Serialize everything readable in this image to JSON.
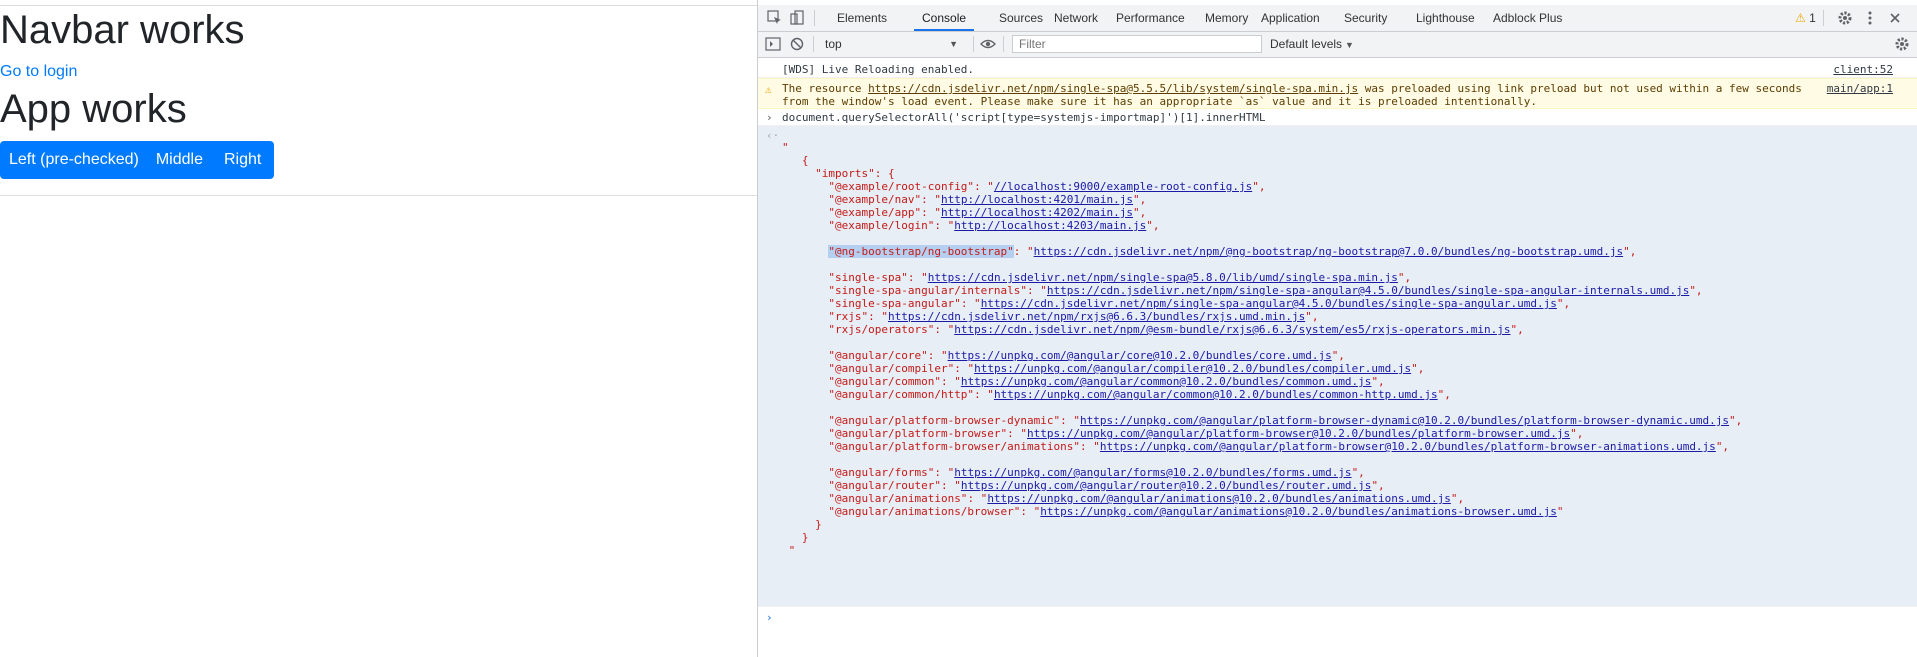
{
  "app": {
    "navbar_heading": "Navbar works",
    "login_link": "Go to login",
    "app_heading": "App works",
    "buttons": [
      "Left (pre-checked)",
      "Middle",
      "Right"
    ]
  },
  "devtools": {
    "tabs": [
      "Elements",
      "Console",
      "Sources",
      "Network",
      "Performance",
      "Memory",
      "Application",
      "Security",
      "Lighthouse",
      "Adblock Plus"
    ],
    "active_tab": "Console",
    "warning_count": "1",
    "context": "top",
    "filter_placeholder": "Filter",
    "levels": "Default levels",
    "messages": {
      "wds": {
        "text": "[WDS] Live Reloading enabled.",
        "source": "client:52"
      },
      "preload": {
        "line1_pre": "The resource ",
        "line1_url": "https://cdn.jsdelivr.net/npm/single-spa@5.5.5/lib/system/single-spa.min.js",
        "line1_post": " was preloaded using link preload but not used within a few seconds",
        "line2": "from the window's load event. Please make sure it has an appropriate `as` value and it is preloaded intentionally.",
        "source": "main/app:1"
      },
      "command": "document.querySelectorAll('script[type=systemjs-importmap]')[1].innerHTML"
    },
    "result": {
      "open_quote": "\"",
      "brace_open": "{",
      "imports_key": "\"imports\": {",
      "groups": [
        [
          {
            "key": "\"@example/root-config\"",
            "url": "//localhost:9000/example-root-config.js"
          },
          {
            "key": "\"@example/nav\"",
            "url": "http://localhost:4201/main.js"
          },
          {
            "key": "\"@example/app\"",
            "url": "http://localhost:4202/main.js"
          },
          {
            "key": "\"@example/login\"",
            "url": "http://localhost:4203/main.js"
          }
        ],
        [
          {
            "key": "\"@ng-bootstrap/ng-bootstrap\"",
            "url": "https://cdn.jsdelivr.net/npm/@ng-bootstrap/ng-bootstrap@7.0.0/bundles/ng-bootstrap.umd.js",
            "highlight": true
          }
        ],
        [
          {
            "key": "\"single-spa\"",
            "url": "https://cdn.jsdelivr.net/npm/single-spa@5.8.0/lib/umd/single-spa.min.js"
          },
          {
            "key": "\"single-spa-angular/internals\"",
            "url": "https://cdn.jsdelivr.net/npm/single-spa-angular@4.5.0/bundles/single-spa-angular-internals.umd.js"
          },
          {
            "key": "\"single-spa-angular\"",
            "url": "https://cdn.jsdelivr.net/npm/single-spa-angular@4.5.0/bundles/single-spa-angular.umd.js"
          },
          {
            "key": "\"rxjs\"",
            "url": "https://cdn.jsdelivr.net/npm/rxjs@6.6.3/bundles/rxjs.umd.min.js"
          },
          {
            "key": "\"rxjs/operators\"",
            "url": "https://cdn.jsdelivr.net/npm/@esm-bundle/rxjs@6.6.3/system/es5/rxjs-operators.min.js"
          }
        ],
        [
          {
            "key": "\"@angular/core\"",
            "url": "https://unpkg.com/@angular/core@10.2.0/bundles/core.umd.js"
          },
          {
            "key": "\"@angular/compiler\"",
            "url": "https://unpkg.com/@angular/compiler@10.2.0/bundles/compiler.umd.js"
          },
          {
            "key": "\"@angular/common\"",
            "url": "https://unpkg.com/@angular/common@10.2.0/bundles/common.umd.js"
          },
          {
            "key": "\"@angular/common/http\"",
            "url": "https://unpkg.com/@angular/common@10.2.0/bundles/common-http.umd.js"
          }
        ],
        [
          {
            "key": "\"@angular/platform-browser-dynamic\"",
            "url": "https://unpkg.com/@angular/platform-browser-dynamic@10.2.0/bundles/platform-browser-dynamic.umd.js"
          },
          {
            "key": "\"@angular/platform-browser\"",
            "url": "https://unpkg.com/@angular/platform-browser@10.2.0/bundles/platform-browser.umd.js"
          },
          {
            "key": "\"@angular/platform-browser/animations\"",
            "url": "https://unpkg.com/@angular/platform-browser@10.2.0/bundles/platform-browser-animations.umd.js"
          }
        ],
        [
          {
            "key": "\"@angular/forms\"",
            "url": "https://unpkg.com/@angular/forms@10.2.0/bundles/forms.umd.js"
          },
          {
            "key": "\"@angular/router\"",
            "url": "https://unpkg.com/@angular/router@10.2.0/bundles/router.umd.js"
          },
          {
            "key": "\"@angular/animations\"",
            "url": "https://unpkg.com/@angular/animations@10.2.0/bundles/animations.umd.js"
          },
          {
            "key": "\"@angular/animations/browser\"",
            "url": "https://unpkg.com/@angular/animations@10.2.0/bundles/animations-browser.umd.js",
            "last": true
          }
        ]
      ],
      "imports_close": "}",
      "brace_close": "}",
      "close_quote": "\""
    }
  },
  "colors": {
    "primary": "#007bff",
    "link": "#007bff",
    "tab_active": "#1a73e8",
    "warn": "#f2a60a",
    "string": "#c41a16"
  }
}
